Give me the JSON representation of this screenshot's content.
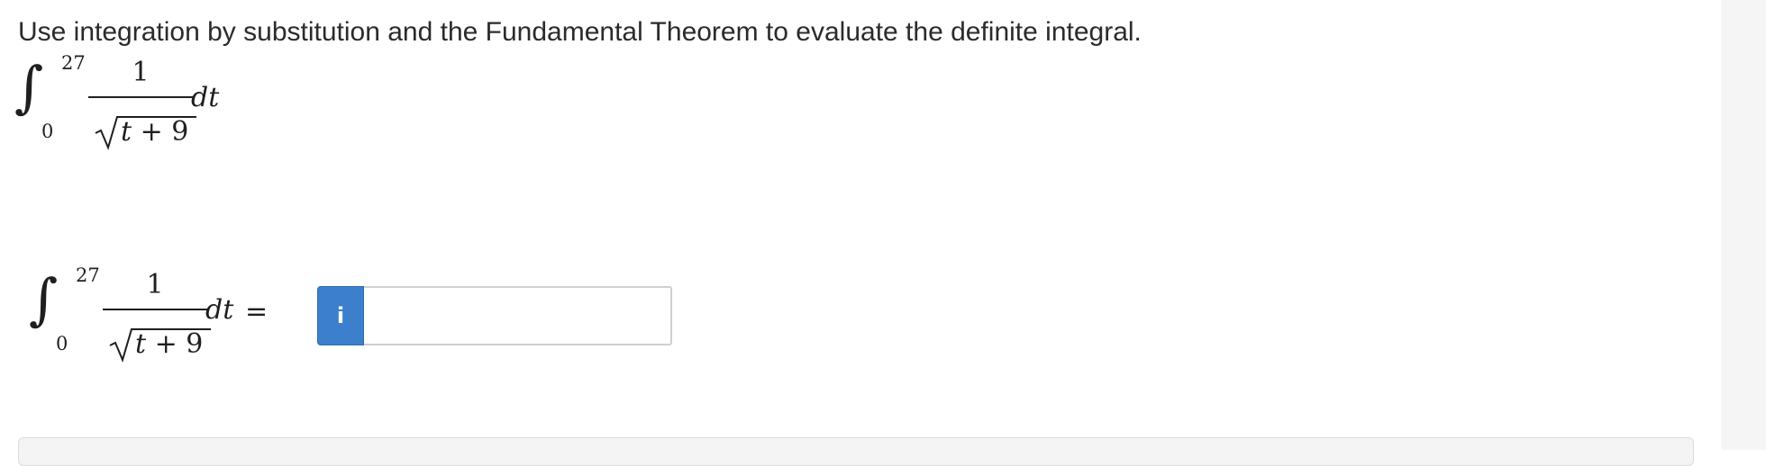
{
  "question": {
    "prompt": "Use integration by substitution and the Fundamental Theorem to evaluate the definite integral."
  },
  "integral_display": {
    "upper_limit": "27",
    "lower_limit": "0",
    "numerator": "1",
    "radicand_var": "t",
    "radicand_rest": " + 9",
    "differential": "dt"
  },
  "answer_row": {
    "upper_limit": "27",
    "lower_limit": "0",
    "numerator": "1",
    "radicand_var": "t",
    "radicand_rest": " + 9",
    "differential": "dt",
    "equals": "=",
    "info_button_label": "i",
    "input_value": "",
    "input_placeholder": ""
  },
  "colors": {
    "info_button": "#3c7fcc",
    "input_border": "#cfcfcf",
    "text": "#2b2b2b"
  },
  "icons": {
    "info": "info-icon"
  }
}
